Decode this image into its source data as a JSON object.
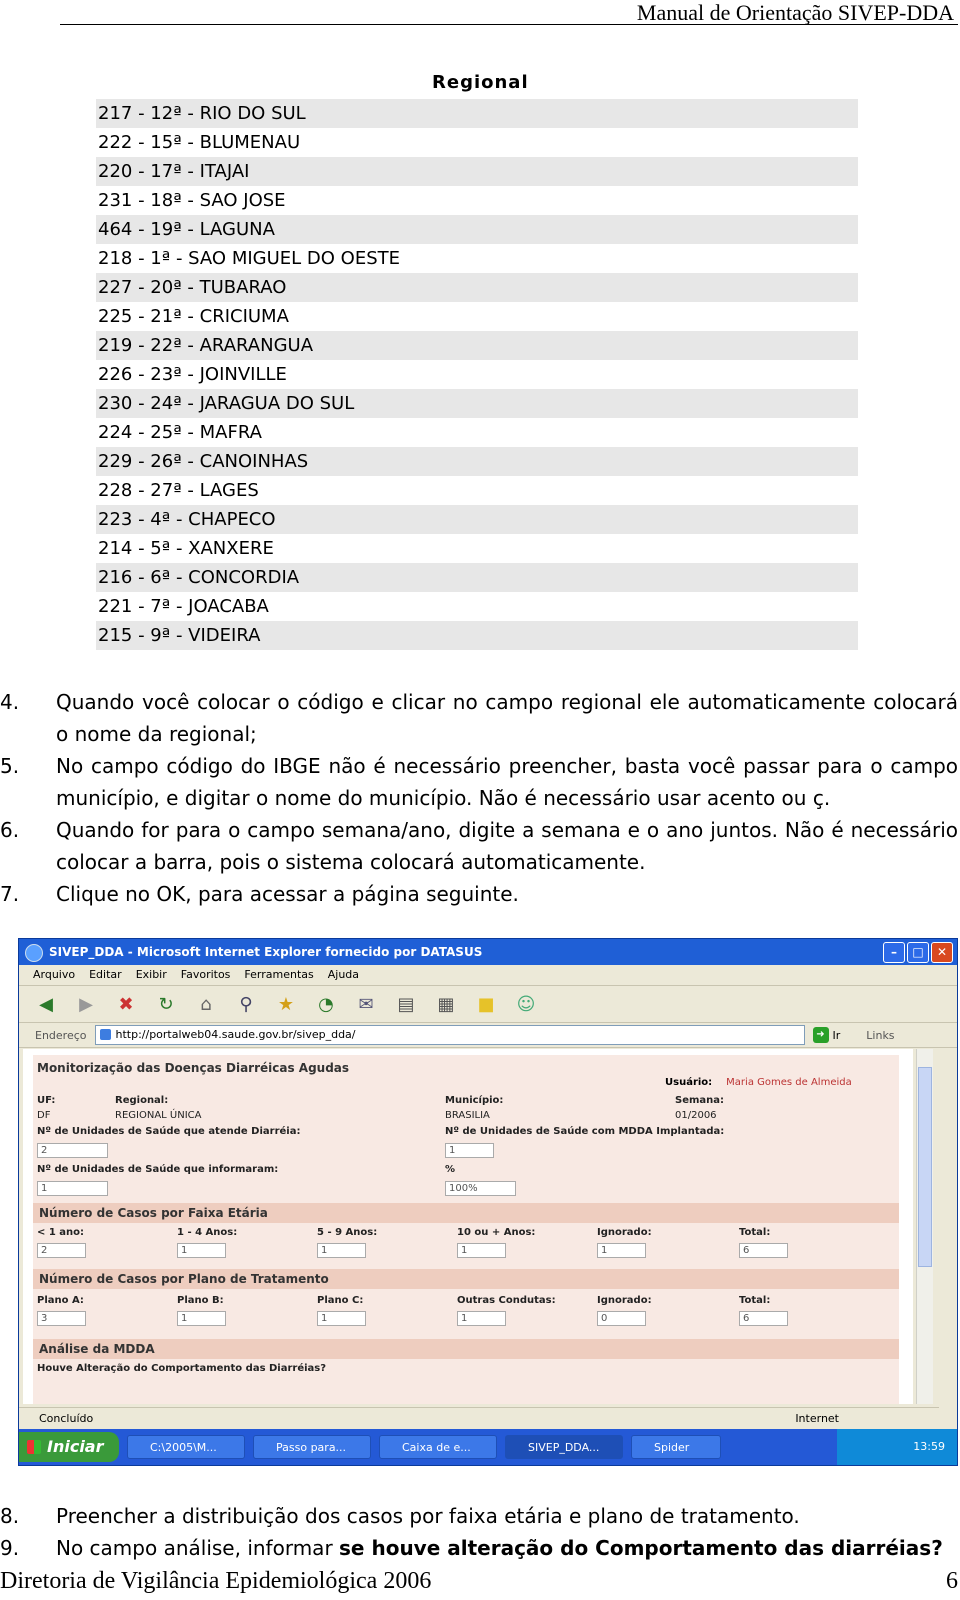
{
  "header": {
    "title": "Manual de Orientação SIVEP-DDA"
  },
  "regional": {
    "title": "Regional",
    "items": [
      "217 - 12ª - RIO DO SUL",
      "222 - 15ª - BLUMENAU",
      "220 - 17ª - ITAJAI",
      "231 - 18ª - SAO JOSE",
      "464 - 19ª - LAGUNA",
      "218 - 1ª - SAO MIGUEL DO OESTE",
      "227 - 20ª - TUBARAO",
      "225 - 21ª - CRICIUMA",
      "219 - 22ª - ARARANGUA",
      "226 - 23ª - JOINVILLE",
      "230 - 24ª - JARAGUA DO SUL",
      "224 - 25ª - MAFRA",
      "229 - 26ª - CANOINHAS",
      "228 - 27ª - LAGES",
      "223 - 4ª - CHAPECO",
      "214 - 5ª - XANXERE",
      "216 - 6ª - CONCORDIA",
      "221 - 7ª - JOACABA",
      "215 - 9ª - VIDEIRA"
    ]
  },
  "steps_before": [
    {
      "num": "4.",
      "text": "Quando você colocar o código e clicar no campo regional ele automaticamente colocará o nome da regional;"
    },
    {
      "num": "5.",
      "text": "No campo código do IBGE não é necessário preencher, basta você passar para o campo município, e digitar o nome do município. Não é necessário usar acento ou ç."
    },
    {
      "num": "6.",
      "text": "Quando for para o campo semana/ano, digite a semana e o ano juntos. Não é necessário colocar a barra, pois o sistema colocará automaticamente."
    },
    {
      "num": "7.",
      "text": "Clique no OK, para acessar a página seguinte."
    }
  ],
  "browser": {
    "title": "SIVEP_DDA - Microsoft Internet Explorer fornecido por DATASUS",
    "menu": [
      "Arquivo",
      "Editar",
      "Exibir",
      "Favoritos",
      "Ferramentas",
      "Ajuda"
    ],
    "address_label": "Endereço",
    "url": "http://portalweb04.saude.gov.br/sivep_dda/",
    "go_label": "Ir",
    "links_label": "Links",
    "status": "Concluído",
    "zone": "Internet"
  },
  "form": {
    "title": "Monitorização das Doenças Diarréicas Agudas",
    "user_label": "Usuário:",
    "user_value": "Maria Gomes de Almeida",
    "uf_label": "UF:",
    "uf_value": "DF",
    "regional_label": "Regional:",
    "regional_value": "REGIONAL ÚNICA",
    "municipio_label": "Município:",
    "municipio_value": "BRASILIA",
    "semana_label": "Semana:",
    "semana_value": "01/2006",
    "units_attend_label": "Nº de Unidades de Saúde que atende Diarréia:",
    "units_attend_value": "2",
    "units_mdda_label": "Nº de Unidades de Saúde com MDDA Implantada:",
    "units_mdda_value": "1",
    "units_inform_label": "Nº de Unidades de Saúde que informaram:",
    "units_inform_value": "1",
    "pct_label": "%",
    "pct_value": "100%",
    "age_section": "Número de Casos por Faixa Etária",
    "age_fields": [
      {
        "label": "< 1 ano:",
        "value": "2"
      },
      {
        "label": "1 - 4 Anos:",
        "value": "1"
      },
      {
        "label": "5 - 9 Anos:",
        "value": "1"
      },
      {
        "label": "10 ou + Anos:",
        "value": "1"
      },
      {
        "label": "Ignorado:",
        "value": "1"
      },
      {
        "label": "Total:",
        "value": "6"
      }
    ],
    "plan_section": "Número de Casos por Plano de Tratamento",
    "plan_fields": [
      {
        "label": "Plano A:",
        "value": "3"
      },
      {
        "label": "Plano B:",
        "value": "1"
      },
      {
        "label": "Plano C:",
        "value": "1"
      },
      {
        "label": "Outras Condutas:",
        "value": "1"
      },
      {
        "label": "Ignorado:",
        "value": "0"
      },
      {
        "label": "Total:",
        "value": "6"
      }
    ],
    "analysis_section": "Análise da MDDA",
    "analysis_question": "Houve Alteração do Comportamento das Diarréias?"
  },
  "taskbar": {
    "start": "Iniciar",
    "tasks": [
      "C:\\2005\\M...",
      "Passo para...",
      "Caixa de e...",
      "SIVEP_DDA...",
      "Spider"
    ],
    "clock": "13:59"
  },
  "steps_after": [
    {
      "num": "8.",
      "text": "Preencher a distribuição dos casos por faixa etária e plano de tratamento."
    },
    {
      "num": "9.",
      "text_plain": "No campo análise, informar ",
      "text_bold": "se houve alteração do Comportamento das diarréias?"
    }
  ],
  "footer": {
    "text": "Diretoria de Vigilância Epidemiológica  2006",
    "page": "6"
  }
}
